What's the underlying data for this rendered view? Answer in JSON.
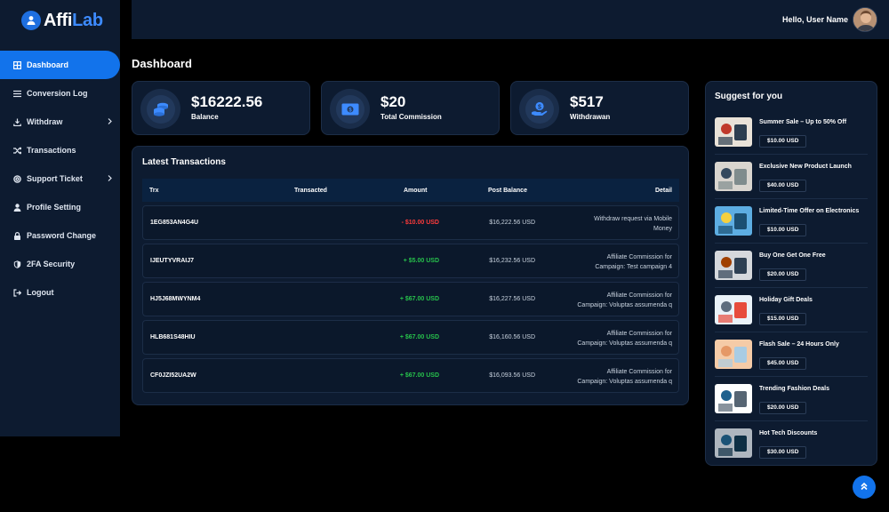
{
  "brand": {
    "name_a": "Affi",
    "name_b": "Lab"
  },
  "sidebar": {
    "items": [
      {
        "label": "Dashboard",
        "icon": "grid-icon",
        "active": true
      },
      {
        "label": "Conversion Log",
        "icon": "list-icon"
      },
      {
        "label": "Withdraw",
        "icon": "download-icon",
        "chevron": true
      },
      {
        "label": "Transactions",
        "icon": "shuffle-icon"
      },
      {
        "label": "Support Ticket",
        "icon": "life-ring-icon",
        "chevron": true
      },
      {
        "label": "Profile Setting",
        "icon": "user-icon"
      },
      {
        "label": "Password Change",
        "icon": "lock-icon"
      },
      {
        "label": "2FA Security",
        "icon": "shield-icon"
      },
      {
        "label": "Logout",
        "icon": "sign-out-icon"
      }
    ]
  },
  "header": {
    "greeting": "Hello, User Name"
  },
  "page": {
    "title": "Dashboard"
  },
  "stats": [
    {
      "value": "$16222.56",
      "label": "Balance",
      "icon": "coins-icon"
    },
    {
      "value": "$20",
      "label": "Total Commission",
      "icon": "money-bill-icon"
    },
    {
      "value": "$517",
      "label": "Withdrawan",
      "icon": "hand-dollar-icon"
    }
  ],
  "transactions": {
    "title": "Latest Transactions",
    "columns": [
      "Trx",
      "Transacted",
      "Amount",
      "Post Balance",
      "Detail"
    ],
    "rows": [
      {
        "trx": "1EG853AN4G4U",
        "amount": "- $10.00 USD",
        "sign": "neg",
        "balance": "$16,222.56 USD",
        "detail_1": "Withdraw request via Mobile",
        "detail_2": "Money"
      },
      {
        "trx": "IJEUTYVRAIJ7",
        "amount": "+ $5.00 USD",
        "sign": "pos",
        "balance": "$16,232.56 USD",
        "detail_1": "Affiliate Commission for",
        "detail_2": "Campaign: Test campaign 4"
      },
      {
        "trx": "HJ5J68MWYNM4",
        "amount": "+ $67.00 USD",
        "sign": "pos",
        "balance": "$16,227.56 USD",
        "detail_1": "Affiliate Commission for",
        "detail_2": "Campaign: Voluptas assumenda q"
      },
      {
        "trx": "HLB681S48HIU",
        "amount": "+ $67.00 USD",
        "sign": "pos",
        "balance": "$16,160.56 USD",
        "detail_1": "Affiliate Commission for",
        "detail_2": "Campaign: Voluptas assumenda q"
      },
      {
        "trx": "CF0JZI52UA2W",
        "amount": "+ $67.00 USD",
        "sign": "pos",
        "balance": "$16,093.56 USD",
        "detail_1": "Affiliate Commission for",
        "detail_2": "Campaign: Voluptas assumenda q"
      }
    ]
  },
  "suggest": {
    "title": "Suggest for you",
    "items": [
      {
        "name": "Summer Sale – Up to 50% Off",
        "price": "$10.00 USD"
      },
      {
        "name": "Exclusive New Product Launch",
        "price": "$40.00 USD"
      },
      {
        "name": "Limited-Time Offer on Electronics",
        "price": "$10.00 USD"
      },
      {
        "name": "Buy One Get One Free",
        "price": "$20.00 USD"
      },
      {
        "name": "Holiday Gift Deals",
        "price": "$15.00 USD"
      },
      {
        "name": "Flash Sale – 24 Hours Only",
        "price": "$45.00 USD"
      },
      {
        "name": "Trending Fashion Deals",
        "price": "$20.00 USD"
      },
      {
        "name": "Hot Tech Discounts",
        "price": "$30.00 USD"
      }
    ]
  },
  "colors": {
    "accent": "#1273eb",
    "panel": "#0d1b30",
    "positive": "#27c24c",
    "negative": "#ff3b3b"
  }
}
